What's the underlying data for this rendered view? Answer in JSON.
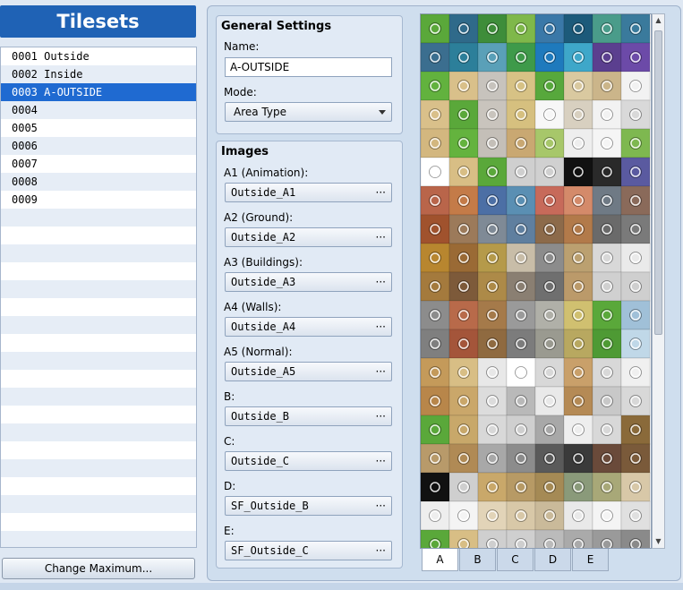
{
  "sidebar": {
    "title": "Tilesets",
    "items": [
      {
        "label": "0001 Outside"
      },
      {
        "label": "0002 Inside"
      },
      {
        "label": "0003 A-OUTSIDE",
        "selected": true
      },
      {
        "label": "0004"
      },
      {
        "label": "0005"
      },
      {
        "label": "0006"
      },
      {
        "label": "0007"
      },
      {
        "label": "0008"
      },
      {
        "label": "0009"
      }
    ],
    "change_max_label": "Change Maximum..."
  },
  "general": {
    "title": "General Settings",
    "name_label": "Name:",
    "name_value": "A-OUTSIDE",
    "mode_label": "Mode:",
    "mode_value": "Area Type"
  },
  "images": {
    "title": "Images",
    "slots": [
      {
        "label": "A1 (Animation):",
        "file": "Outside_A1"
      },
      {
        "label": "A2 (Ground):",
        "file": "Outside_A2"
      },
      {
        "label": "A3 (Buildings):",
        "file": "Outside_A3"
      },
      {
        "label": "A4 (Walls):",
        "file": "Outside_A4"
      },
      {
        "label": "A5 (Normal):",
        "file": "Outside_A5"
      },
      {
        "label": "B:",
        "file": "Outside_B"
      },
      {
        "label": "C:",
        "file": "Outside_C"
      },
      {
        "label": "D:",
        "file": "SF_Outside_B"
      },
      {
        "label": "E:",
        "file": "SF_Outside_C"
      }
    ],
    "browse_glyph": "···"
  },
  "palette_tabs": [
    {
      "label": "A",
      "active": true
    },
    {
      "label": "B"
    },
    {
      "label": "C"
    },
    {
      "label": "D"
    },
    {
      "label": "E"
    }
  ],
  "colors": {
    "accent": "#1f62b5",
    "selection": "#1f6ad1",
    "panel": "#cfdeee"
  },
  "tile_rows": [
    [
      "#5aa83a",
      "#2f6a8a",
      "#3e8d3a",
      "#7fb84a",
      "#3a78a8",
      "#1c5a7a",
      "#4a9c8a",
      "#3a7a9c"
    ],
    [
      "#3b6e8f",
      "#2c7f9a",
      "#5aa0b8",
      "#3e9a4a",
      "#1e7abd",
      "#3ea7c9",
      "#5b3f8f",
      "#6c4aa8"
    ],
    [
      "#62b23e",
      "#d9c08a",
      "#c7c3bd",
      "#d7c285",
      "#57a83c",
      "#d9c9a0",
      "#cbb58a",
      "#f2f2f2"
    ],
    [
      "#d9c08a",
      "#5aa83a",
      "#c9c4bd",
      "#d6c07f",
      "#f7f7f7",
      "#d8d0c0",
      "#f2f2f2",
      "#d9d9d9"
    ],
    [
      "#d3b77f",
      "#64b33e",
      "#c4bfb8",
      "#c9a872",
      "#a7c76a",
      "#eeeeee",
      "#f5f5f5",
      "#7eb850"
    ],
    [
      "#ffffff",
      "#d8be85",
      "#5aa83a",
      "#cfcfcf",
      "#d0d0d0",
      "#111111",
      "#2a2a2a",
      "#5a5aa0"
    ],
    [
      "#b9654a",
      "#c47b48",
      "#4c6fa5",
      "#5a8fb3",
      "#c76a5a",
      "#d48a6a",
      "#6f7a85",
      "#8a6a5a"
    ],
    [
      "#a0522d",
      "#9c7a5a",
      "#7f8a96",
      "#5f7f9f",
      "#8c6a4a",
      "#b27a4a",
      "#6a6a6a",
      "#7a7a7a"
    ],
    [
      "#b8862f",
      "#9a6a35",
      "#b59a4a",
      "#c8bda8",
      "#8c8c8c",
      "#bba070",
      "#d8d8d8",
      "#eaeaea"
    ],
    [
      "#a47a3d",
      "#7d5a3a",
      "#ad8a48",
      "#8a7f72",
      "#6f6f6f",
      "#bb9a6a",
      "#d0d0d0",
      "#cfcfcf"
    ],
    [
      "#8c8c8c",
      "#b86a4a",
      "#a57a4a",
      "#9a9a9a",
      "#b0b0a8",
      "#d0c070",
      "#5aa83a",
      "#a0c0d8"
    ],
    [
      "#7f7f7f",
      "#a4553a",
      "#8f6a40",
      "#7c7c7c",
      "#9a9a90",
      "#b8a860",
      "#4e9a34",
      "#c0d8e8"
    ],
    [
      "#c49a5a",
      "#d8be85",
      "#e8e8e8",
      "#ffffff",
      "#d8d8d8",
      "#c9a06a",
      "#d8d8d8",
      "#f0f0f0"
    ],
    [
      "#b8864a",
      "#caa76a",
      "#dcdcdc",
      "#b9b9b9",
      "#e9e9e9",
      "#b58a55",
      "#c8c8c8",
      "#d8d8d8"
    ],
    [
      "#5aa83a",
      "#c8a86a",
      "#d8d8d8",
      "#cfcfcf",
      "#a8a8a8",
      "#eeeeee",
      "#d8d8d8",
      "#8a6a3a"
    ],
    [
      "#b89a6a",
      "#b08a55",
      "#a8a8a8",
      "#8c8c8c",
      "#5a5a5a",
      "#3a3a3a",
      "#6a4a3a",
      "#7a5a3a"
    ],
    [
      "#111111",
      "#cfcfcf",
      "#c9a86a",
      "#b79a65",
      "#a58a55",
      "#8a9a7a",
      "#a8a878",
      "#d8c8a8"
    ],
    [
      "#eeeeee",
      "#f4f4f4",
      "#e2d4b8",
      "#d8c8a8",
      "#caba9a",
      "#e9e9e9",
      "#f4f4f4",
      "#e0e0e0"
    ],
    [
      "#5aa83a",
      "#d8be85",
      "#cfcfcf",
      "#cfcfcf",
      "#bbbbbb",
      "#aaaaaa",
      "#9a9a9a",
      "#8a8a8a"
    ]
  ]
}
